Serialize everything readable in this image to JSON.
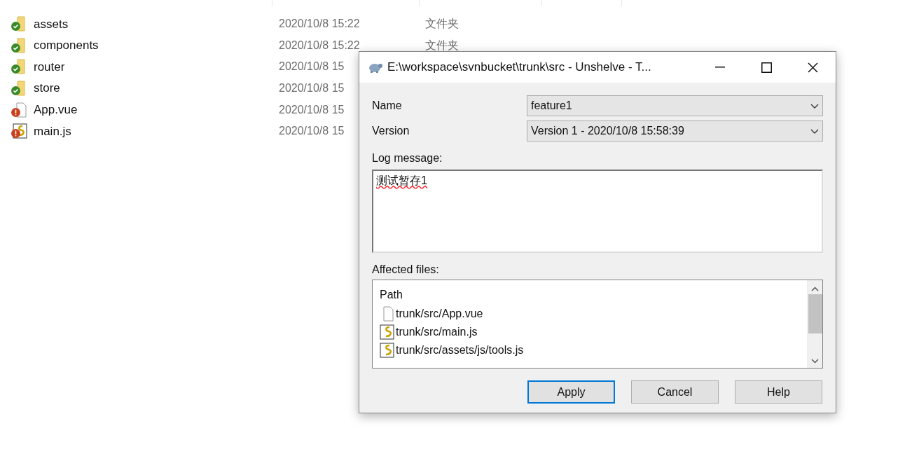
{
  "explorer": {
    "rows": [
      {
        "name": "assets",
        "kind": "folder",
        "modified": false,
        "date": "2020/10/8 15:22",
        "type": "文件夹"
      },
      {
        "name": "components",
        "kind": "folder",
        "modified": false,
        "date": "2020/10/8 15:22",
        "type": "文件夹"
      },
      {
        "name": "router",
        "kind": "folder",
        "modified": false,
        "date": "2020/10/8 15"
      },
      {
        "name": "store",
        "kind": "folder",
        "modified": false,
        "date": "2020/10/8 15"
      },
      {
        "name": "App.vue",
        "kind": "file",
        "modified": true,
        "date": "2020/10/8 15"
      },
      {
        "name": "main.js",
        "kind": "script",
        "modified": true,
        "date": "2020/10/8 15"
      }
    ]
  },
  "dialog": {
    "title": "E:\\workspace\\svnbucket\\trunk\\src - Unshelve - T...",
    "fields": [
      {
        "label": "Name",
        "value": "feature1"
      },
      {
        "label": "Version",
        "value": "Version 1 - 2020/10/8 15:58:39"
      }
    ],
    "log_label": "Log message:",
    "log_message": "测试暂存1",
    "files_label": "Affected files:",
    "files_column": "Path",
    "files": [
      {
        "path": "trunk/src/App.vue",
        "kind": "file"
      },
      {
        "path": "trunk/src/main.js",
        "kind": "script"
      },
      {
        "path": "trunk/src/assets/js/tools.js",
        "kind": "script"
      }
    ],
    "buttons": [
      {
        "label": "Apply",
        "default": true
      },
      {
        "label": "Cancel",
        "default": false
      },
      {
        "label": "Help",
        "default": false
      }
    ]
  }
}
